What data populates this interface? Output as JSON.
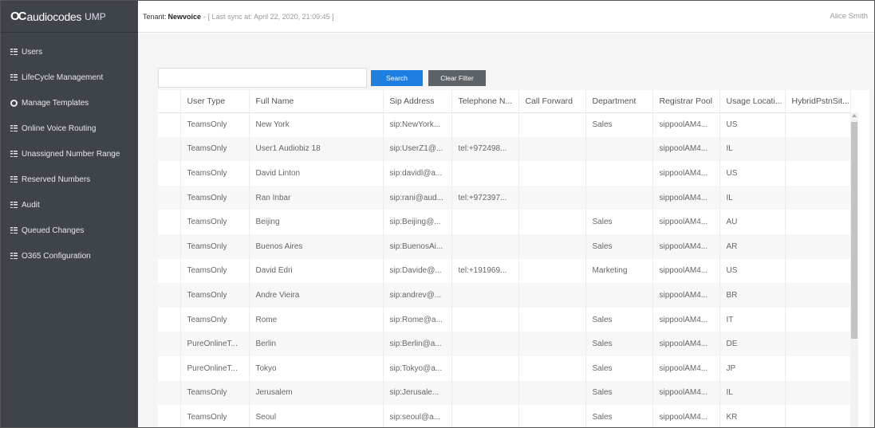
{
  "app": {
    "brand_mark": "OC",
    "brand_name": "audiocodes",
    "product": "UMP"
  },
  "sidebar": {
    "items": [
      {
        "label": "Users",
        "icon": "grid-icon"
      },
      {
        "label": "LifeCycle Management",
        "icon": "grid-icon"
      },
      {
        "label": "Manage Templates",
        "icon": "gear-icon"
      },
      {
        "label": "Online Voice Routing",
        "icon": "grid-icon"
      },
      {
        "label": "Unassigned Number Range",
        "icon": "grid-icon"
      },
      {
        "label": "Reserved Numbers",
        "icon": "grid-icon"
      },
      {
        "label": "Audit",
        "icon": "grid-icon"
      },
      {
        "label": "Queued Changes",
        "icon": "grid-icon"
      },
      {
        "label": "O365 Configuration",
        "icon": "grid-icon"
      }
    ]
  },
  "header": {
    "tenant_label": "Tenant:",
    "tenant_name": "Newvoice",
    "sync_text": "- [ Last sync at: April 22, 2020, 21:09:45 ]",
    "user": "Alice Smith"
  },
  "search": {
    "value": "",
    "search_label": "Search",
    "clear_label": "Clear Filter"
  },
  "table": {
    "columns": [
      "",
      "User Type",
      "Full Name",
      "Sip Address",
      "Telephone N...",
      "Call Forward",
      "Department",
      "Registrar Pool",
      "Usage Locati...",
      "HybridPstnSit..."
    ],
    "rows": [
      [
        "",
        "TeamsOnly",
        "New York",
        "sip:NewYork...",
        "",
        "",
        "Sales",
        "sippoolAM4...",
        "US",
        ""
      ],
      [
        "",
        "TeamsOnly",
        "User1 Audiobiz 18",
        "sip:UserZ1@...",
        "tel:+972498...",
        "",
        "",
        "sippoolAM4...",
        "IL",
        ""
      ],
      [
        "",
        "TeamsOnly",
        "David Linton",
        "sip:davidl@a...",
        "",
        "",
        "",
        "sippoolAM4...",
        "US",
        ""
      ],
      [
        "",
        "TeamsOnly",
        "Ran Inbar",
        "sip:rani@aud...",
        "tel:+972397...",
        "",
        "",
        "sippoolAM4...",
        "IL",
        ""
      ],
      [
        "",
        "TeamsOnly",
        "Beijing",
        "sip:Beijing@...",
        "",
        "",
        "Sales",
        "sippoolAM4...",
        "AU",
        ""
      ],
      [
        "",
        "TeamsOnly",
        "Buenos Aires",
        "sip:BuenosAi...",
        "",
        "",
        "Sales",
        "sippoolAM4...",
        "AR",
        ""
      ],
      [
        "",
        "TeamsOnly",
        "David Edri",
        "sip:Davide@...",
        "tel:+191969...",
        "",
        "Marketing",
        "sippoolAM4...",
        "US",
        ""
      ],
      [
        "",
        "TeamsOnly",
        "Andre Vieira",
        "sip:andrev@...",
        "",
        "",
        "",
        "sippoolAM4...",
        "BR",
        ""
      ],
      [
        "",
        "TeamsOnly",
        "Rome",
        "sip:Rome@a...",
        "",
        "",
        "Sales",
        "sippoolAM4...",
        "IT",
        ""
      ],
      [
        "",
        "PureOnlineT...",
        "Berlin",
        "sip:Berlin@a...",
        "",
        "",
        "Sales",
        "sippoolAM4...",
        "DE",
        ""
      ],
      [
        "",
        "PureOnlineT...",
        "Tokyo",
        "sip:Tokyo@a...",
        "",
        "",
        "Sales",
        "sippoolAM4...",
        "JP",
        ""
      ],
      [
        "",
        "TeamsOnly",
        "Jerusalem",
        "sip:Jerusale...",
        "",
        "",
        "Sales",
        "sippoolAM4...",
        "IL",
        ""
      ],
      [
        "",
        "TeamsOnly",
        "Seoul",
        "sip:seoul@a...",
        "",
        "",
        "Sales",
        "sippoolAM4...",
        "KR",
        ""
      ]
    ]
  },
  "colors": {
    "sidebar_bg": "#3e4449",
    "search_button": "#1e7fe0",
    "clear_button": "#5d6266"
  }
}
